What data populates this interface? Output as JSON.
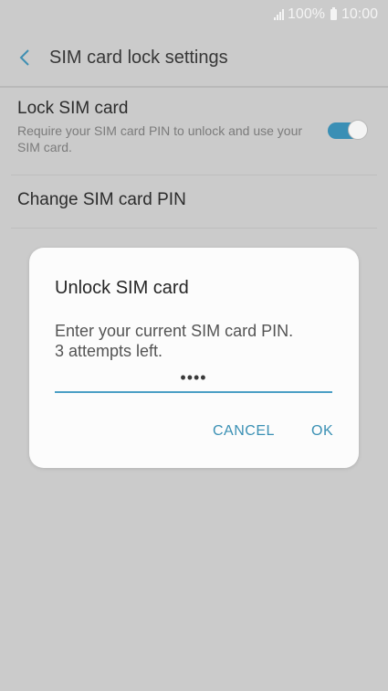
{
  "status_bar": {
    "battery": "100%",
    "time": "10:00"
  },
  "header": {
    "title": "SIM card lock settings"
  },
  "settings": {
    "lock_sim": {
      "title": "Lock SIM card",
      "subtitle": "Require your SIM card PIN to unlock and use your SIM card.",
      "enabled": true
    },
    "change_pin": {
      "title": "Change SIM card PIN"
    }
  },
  "dialog": {
    "title": "Unlock SIM card",
    "message_line1": "Enter your current SIM card PIN.",
    "message_line2": "3 attempts left.",
    "pin_value": "••••",
    "cancel_label": "CANCEL",
    "ok_label": "OK"
  },
  "colors": {
    "accent": "#3a90b4",
    "background": "#cbcbcb",
    "dialog": "#fcfcfc"
  }
}
